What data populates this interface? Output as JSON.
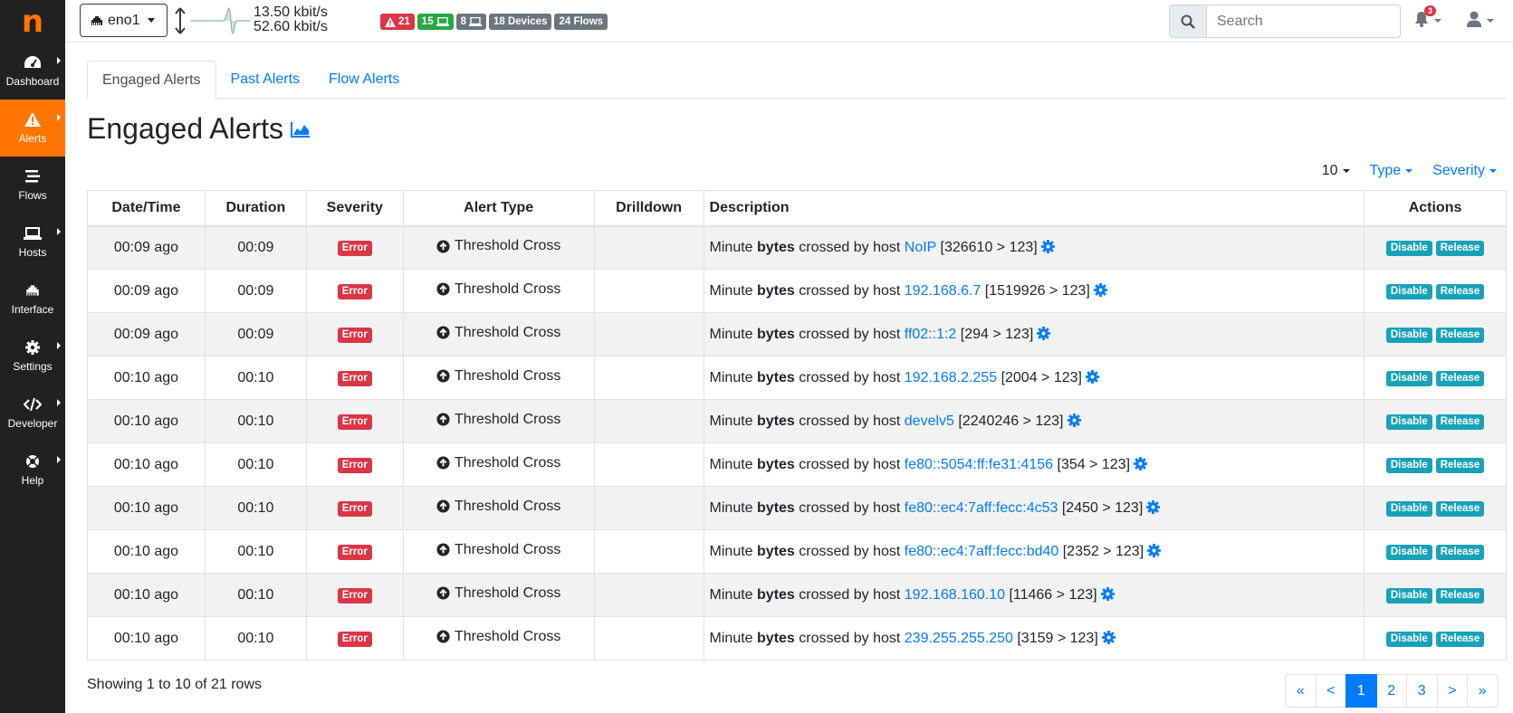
{
  "logo": "n",
  "sidebar": {
    "items": [
      {
        "label": "Dashboard",
        "icon": "gauge-icon",
        "active": false,
        "submenu": true
      },
      {
        "label": "Alerts",
        "icon": "warning-icon",
        "active": true,
        "submenu": true
      },
      {
        "label": "Flows",
        "icon": "stream-icon",
        "active": false,
        "submenu": false
      },
      {
        "label": "Hosts",
        "icon": "laptop-icon",
        "active": false,
        "submenu": true
      },
      {
        "label": "Interface",
        "icon": "ethernet-icon",
        "active": false,
        "submenu": false
      },
      {
        "label": "Settings",
        "icon": "gear-icon",
        "active": false,
        "submenu": true
      },
      {
        "label": "Developer",
        "icon": "code-icon",
        "active": false,
        "submenu": true
      },
      {
        "label": "Help",
        "icon": "lifebuoy-icon",
        "active": false,
        "submenu": true
      }
    ]
  },
  "topbar": {
    "interface": "eno1",
    "upload_rate": "13.50 kbit/s",
    "download_rate": "52.60 kbit/s",
    "badges": {
      "alerts": "21",
      "local_hosts": "15",
      "remote_hosts": "8",
      "devices": "18 Devices",
      "flows": "24 Flows"
    },
    "search_placeholder": "Search",
    "notifications": "3"
  },
  "tabs": [
    {
      "label": "Engaged Alerts",
      "active": true
    },
    {
      "label": "Past Alerts",
      "active": false
    },
    {
      "label": "Flow Alerts",
      "active": false
    }
  ],
  "page_title": "Engaged Alerts",
  "filters": {
    "page_size": "10",
    "type": "Type",
    "severity": "Severity"
  },
  "table": {
    "headers": [
      "Date/Time",
      "Duration",
      "Severity",
      "Alert Type",
      "Drilldown",
      "Description",
      "Actions"
    ],
    "desc_prefix": "Minute",
    "desc_bold": "bytes",
    "desc_mid": "crossed by host",
    "severity_label": "Error",
    "alert_type": "Threshold Cross",
    "disable_label": "Disable",
    "release_label": "Release",
    "rows": [
      {
        "datetime": "00:09 ago",
        "duration": "00:09",
        "host": "NoIP",
        "value": "[326610 > 123]"
      },
      {
        "datetime": "00:09 ago",
        "duration": "00:09",
        "host": "192.168.6.7",
        "value": "[1519926 > 123]"
      },
      {
        "datetime": "00:09 ago",
        "duration": "00:09",
        "host": "ff02::1:2",
        "value": "[294 > 123]"
      },
      {
        "datetime": "00:10 ago",
        "duration": "00:10",
        "host": "192.168.2.255",
        "value": "[2004 > 123]"
      },
      {
        "datetime": "00:10 ago",
        "duration": "00:10",
        "host": "develv5",
        "value": "[2240246 > 123]"
      },
      {
        "datetime": "00:10 ago",
        "duration": "00:10",
        "host": "fe80::5054:ff:fe31:4156",
        "value": "[354 > 123]"
      },
      {
        "datetime": "00:10 ago",
        "duration": "00:10",
        "host": "fe80::ec4:7aff:fecc:4c53",
        "value": "[2450 > 123]"
      },
      {
        "datetime": "00:10 ago",
        "duration": "00:10",
        "host": "fe80::ec4:7aff:fecc:bd40",
        "value": "[2352 > 123]"
      },
      {
        "datetime": "00:10 ago",
        "duration": "00:10",
        "host": "192.168.160.10",
        "value": "[11466 > 123]"
      },
      {
        "datetime": "00:10 ago",
        "duration": "00:10",
        "host": "239.255.255.250",
        "value": "[3159 > 123]"
      }
    ]
  },
  "footer": {
    "showing": "Showing 1 to 10 of 21 rows",
    "pages": [
      "«",
      "<",
      "1",
      "2",
      "3",
      ">",
      "»"
    ],
    "active_page": "1"
  },
  "colors": {
    "brand": "#ff7500",
    "link": "#007bff",
    "error": "#dc3545",
    "action": "#17a2b8"
  }
}
